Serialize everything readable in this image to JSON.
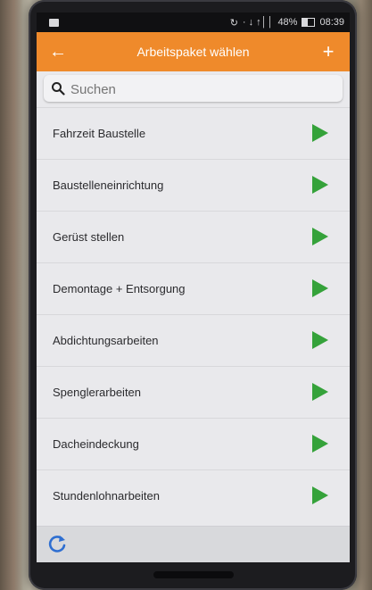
{
  "status_bar": {
    "battery_percent": "48%",
    "time": "08:39",
    "signal": "· ↓ ↑││",
    "icons": [
      "sync-icon",
      "wifi-icon",
      "signal-icon",
      "battery-icon"
    ]
  },
  "app_bar": {
    "title": "Arbeitspaket wählen",
    "back_icon": "←",
    "add_icon": "+"
  },
  "search": {
    "placeholder": "Suchen",
    "value": ""
  },
  "list": {
    "items": [
      {
        "label": "Fahrzeit Baustelle"
      },
      {
        "label": "Baustelleneinrichtung"
      },
      {
        "label": "Gerüst stellen"
      },
      {
        "label": "Demontage + Entsorgung"
      },
      {
        "label": "Abdichtungsarbeiten"
      },
      {
        "label": "Spenglerarbeiten"
      },
      {
        "label": "Dacheindeckung"
      },
      {
        "label": "Stundenlohnarbeiten"
      }
    ]
  },
  "colors": {
    "app_bar": "#ef8a2b",
    "play_button": "#35a23a",
    "refresh_icon": "#2f6fd1"
  }
}
